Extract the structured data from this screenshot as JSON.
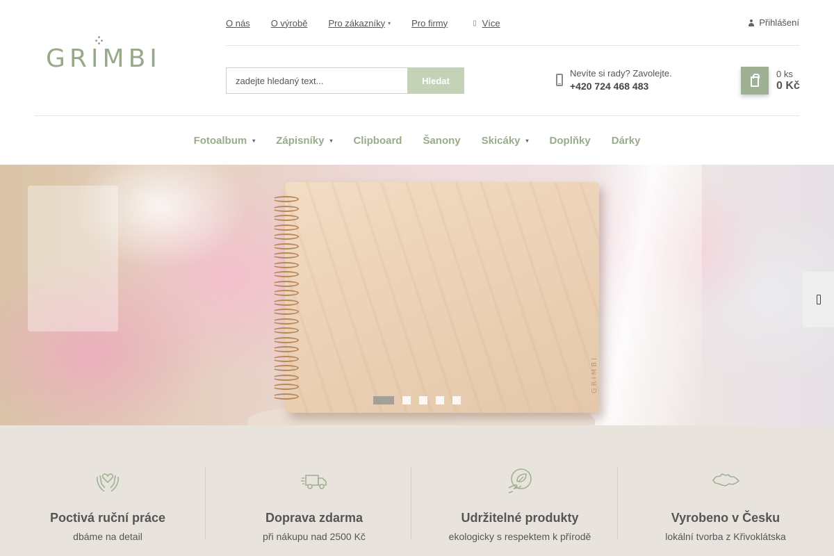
{
  "brand": {
    "logo_text": "GRIMBI"
  },
  "topnav": {
    "links": [
      {
        "label": "O nás"
      },
      {
        "label": "O výrobě"
      },
      {
        "label": "Pro zákazníky"
      },
      {
        "label": "Pro firmy"
      }
    ],
    "more_label": "Více",
    "login_label": "Přihlášení"
  },
  "search": {
    "placeholder": "zadejte hledaný text...",
    "button_label": "Hledat"
  },
  "contact": {
    "question": "Nevíte si rady? Zavolejte.",
    "phone": "+420 724 468 483"
  },
  "cart": {
    "count": "0 ks",
    "price": "0 Kč"
  },
  "mainnav": {
    "items": [
      {
        "label": "Fotoalbum",
        "has_submenu": true
      },
      {
        "label": "Zápisníky",
        "has_submenu": true
      },
      {
        "label": "Clipboard",
        "has_submenu": false
      },
      {
        "label": "Šanony",
        "has_submenu": false
      },
      {
        "label": "Skicáky",
        "has_submenu": true
      },
      {
        "label": "Doplňky",
        "has_submenu": false
      },
      {
        "label": "Dárky",
        "has_submenu": false
      }
    ]
  },
  "hero": {
    "slide_count": 5,
    "active_slide": 1,
    "product_brand": "GRIMBI"
  },
  "benefits": [
    {
      "icon": "hands-heart-icon",
      "title": "Poctivá ruční práce",
      "subtitle": "dbáme na detail"
    },
    {
      "icon": "delivery-truck-icon",
      "title": "Doprava zdarma",
      "subtitle": "při nákupu nad 2500 Kč"
    },
    {
      "icon": "eco-hand-leaf-icon",
      "title": "Udržitelné produkty",
      "subtitle": "ekologicky s respektem k přírodě"
    },
    {
      "icon": "czech-map-icon",
      "title": "Vyrobeno v Česku",
      "subtitle": "lokální tvorba z Křivoklátska"
    }
  ],
  "colors": {
    "accent": "#9fb193",
    "accent_light": "#c4d2b7",
    "nav_text": "#9aab8c",
    "benefits_bg": "#e8e4dd"
  }
}
